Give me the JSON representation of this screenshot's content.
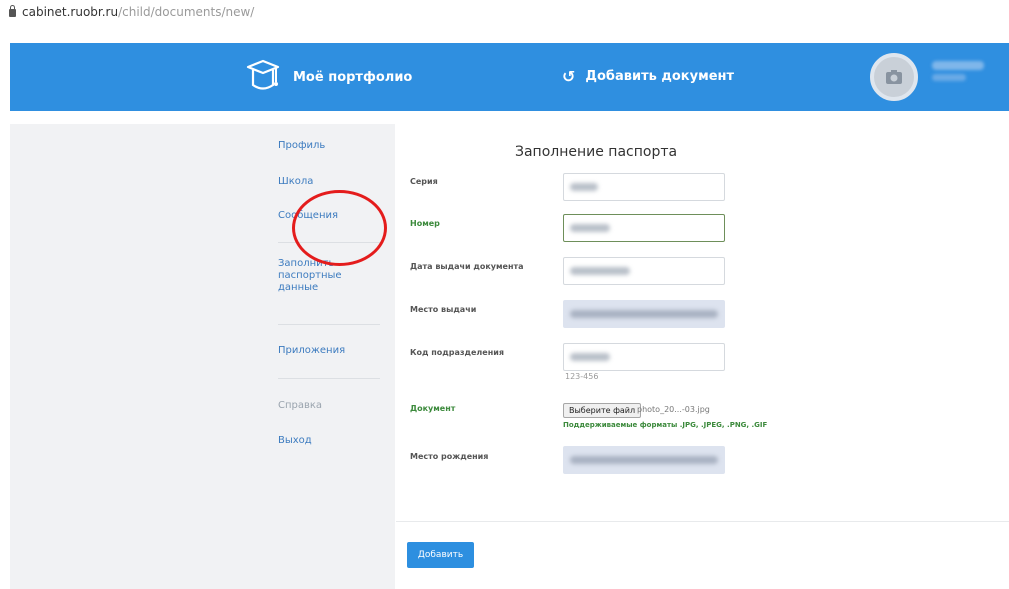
{
  "browser": {
    "url_host": "cabinet.ruobr.ru",
    "url_path": "/child/documents/new/"
  },
  "header": {
    "brand_label": "Моё портфолио",
    "add_document_label": "Добавить документ",
    "accent_color": "#2f8fe0"
  },
  "sidebar": {
    "items": [
      {
        "label": "Профиль"
      },
      {
        "label": "Школа"
      },
      {
        "label": "Сообщения"
      },
      {
        "label": "Заполнить паспортные данные"
      },
      {
        "label": "Приложения"
      },
      {
        "label": "Справка"
      },
      {
        "label": "Выход"
      }
    ]
  },
  "form": {
    "title": "Заполнение паспорта",
    "fields": [
      {
        "label": "Серия"
      },
      {
        "label": "Номер"
      },
      {
        "label": "Дата выдачи документа"
      },
      {
        "label": "Место выдачи"
      },
      {
        "label": "Код подразделения",
        "hint": "123-456"
      },
      {
        "label": "Документ"
      },
      {
        "label": "Место рождения"
      }
    ],
    "file_button_label": "Выберите файл",
    "file_name": "photo_20...-03.jpg",
    "formats_note": "Поддерживаемые форматы .JPG, .JPEG, .PNG, .GIF",
    "submit_label": "Добавить"
  }
}
